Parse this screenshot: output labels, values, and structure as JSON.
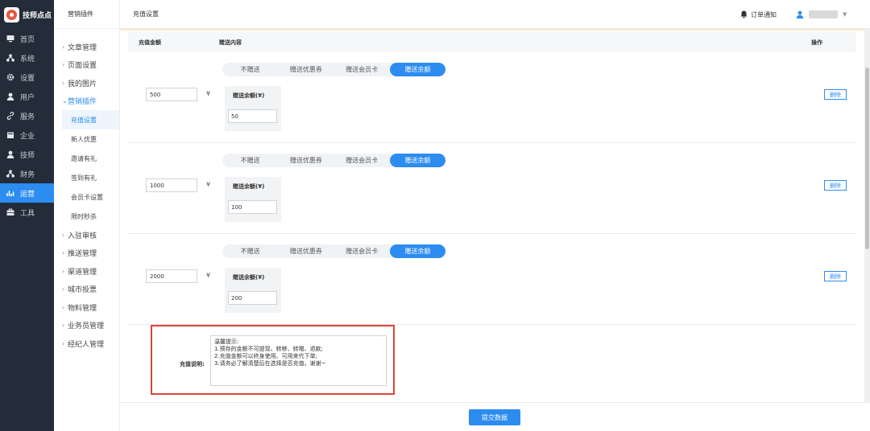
{
  "brand": {
    "name": "技师点点"
  },
  "nav": [
    {
      "label": "首页",
      "icon": "monitor-icon"
    },
    {
      "label": "系统",
      "icon": "sitemap-icon"
    },
    {
      "label": "设置",
      "icon": "gear-icon"
    },
    {
      "label": "用户",
      "icon": "user-icon"
    },
    {
      "label": "服务",
      "icon": "link-icon"
    },
    {
      "label": "企业",
      "icon": "building-icon"
    },
    {
      "label": "技师",
      "icon": "user-icon"
    },
    {
      "label": "财务",
      "icon": "sitemap-icon"
    },
    {
      "label": "运营",
      "icon": "chart-icon"
    },
    {
      "label": "工具",
      "icon": "briefcase-icon"
    }
  ],
  "subsidebar": {
    "header": "营销插件",
    "items_before": [
      "文章管理",
      "页面设置",
      "我的图片"
    ],
    "open_item": "营销插件",
    "children": [
      "充值设置",
      "新人优惠",
      "邀请有礼",
      "签到有礼",
      "会员卡设置",
      "限时秒杀"
    ],
    "items_after": [
      "入驻审核",
      "推送管理",
      "渠道管理",
      "城市投票",
      "物料管理",
      "业务员管理",
      "经纪人管理"
    ]
  },
  "topbar": {
    "title": "充值设置",
    "notify": "订单通知"
  },
  "table": {
    "headers": [
      "充值金额",
      "赠送内容",
      "操作"
    ],
    "currency": "¥",
    "tabs": [
      "不赠送",
      "赠送优惠券",
      "赠送会员卡",
      "赠送余额"
    ],
    "gift_label": "赠送余额(¥)",
    "delete_label": "删除",
    "rows": [
      {
        "amount": "500",
        "gift": "50"
      },
      {
        "amount": "1000",
        "gift": "100"
      },
      {
        "amount": "2000",
        "gift": "200"
      }
    ]
  },
  "description": {
    "label": "充值说明:",
    "lines": [
      "温馨提示:",
      "1.预存的金额不可提现、转移、转赠、退款;",
      "2.充值金额可以终身使用、可用来代下单;",
      "3.请务必了解清楚后在选择是否充值，谢谢~"
    ]
  },
  "footer": {
    "submit_label": "提交数据"
  },
  "colors": {
    "accent": "#2d8cf0",
    "sidebar": "#232c38",
    "highlight": "#d9463a"
  }
}
